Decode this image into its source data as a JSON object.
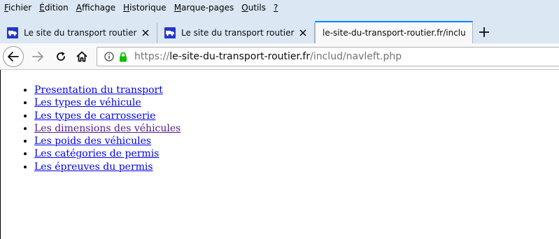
{
  "menubar": {
    "items": [
      {
        "accel": "F",
        "rest": "ichier"
      },
      {
        "accel": "É",
        "rest": "dition"
      },
      {
        "accel": "A",
        "rest": "ffichage"
      },
      {
        "accel": "H",
        "rest": "istorique"
      },
      {
        "accel": "M",
        "rest": "arque-pages"
      },
      {
        "accel": "O",
        "rest": "utils"
      },
      {
        "accel": "?",
        "rest": ""
      }
    ]
  },
  "tabs": [
    {
      "label": "Le site du transport routier"
    },
    {
      "label": "Le site du transport routier"
    },
    {
      "label": "le-site-du-transport-routier.fr/inclu"
    }
  ],
  "urlbar": {
    "scheme": "https://",
    "host": "le-site-du-transport-routier.fr",
    "path": "/includ/navleft.php"
  },
  "links": [
    {
      "label": "Presentation du transport"
    },
    {
      "label": "Les types de véhicule"
    },
    {
      "label": "Les types de carrosserie"
    },
    {
      "label": "Les dimensions des véhicules"
    },
    {
      "label": "Les poids des véhicules"
    },
    {
      "label": "Les catégories de permis"
    },
    {
      "label": "Les épreuves du permis"
    }
  ],
  "colors": {
    "chrome": "#dbe7f3",
    "tab_accent": "#0a84ff",
    "link": "#0000ee",
    "link_visited": "#551a8b",
    "secure_lock": "#12bc00"
  },
  "icons": [
    "truck-favicon-icon",
    "close-icon",
    "plus-icon",
    "back-arrow-icon",
    "forward-arrow-icon",
    "reload-icon",
    "home-icon",
    "info-icon",
    "lock-icon"
  ]
}
